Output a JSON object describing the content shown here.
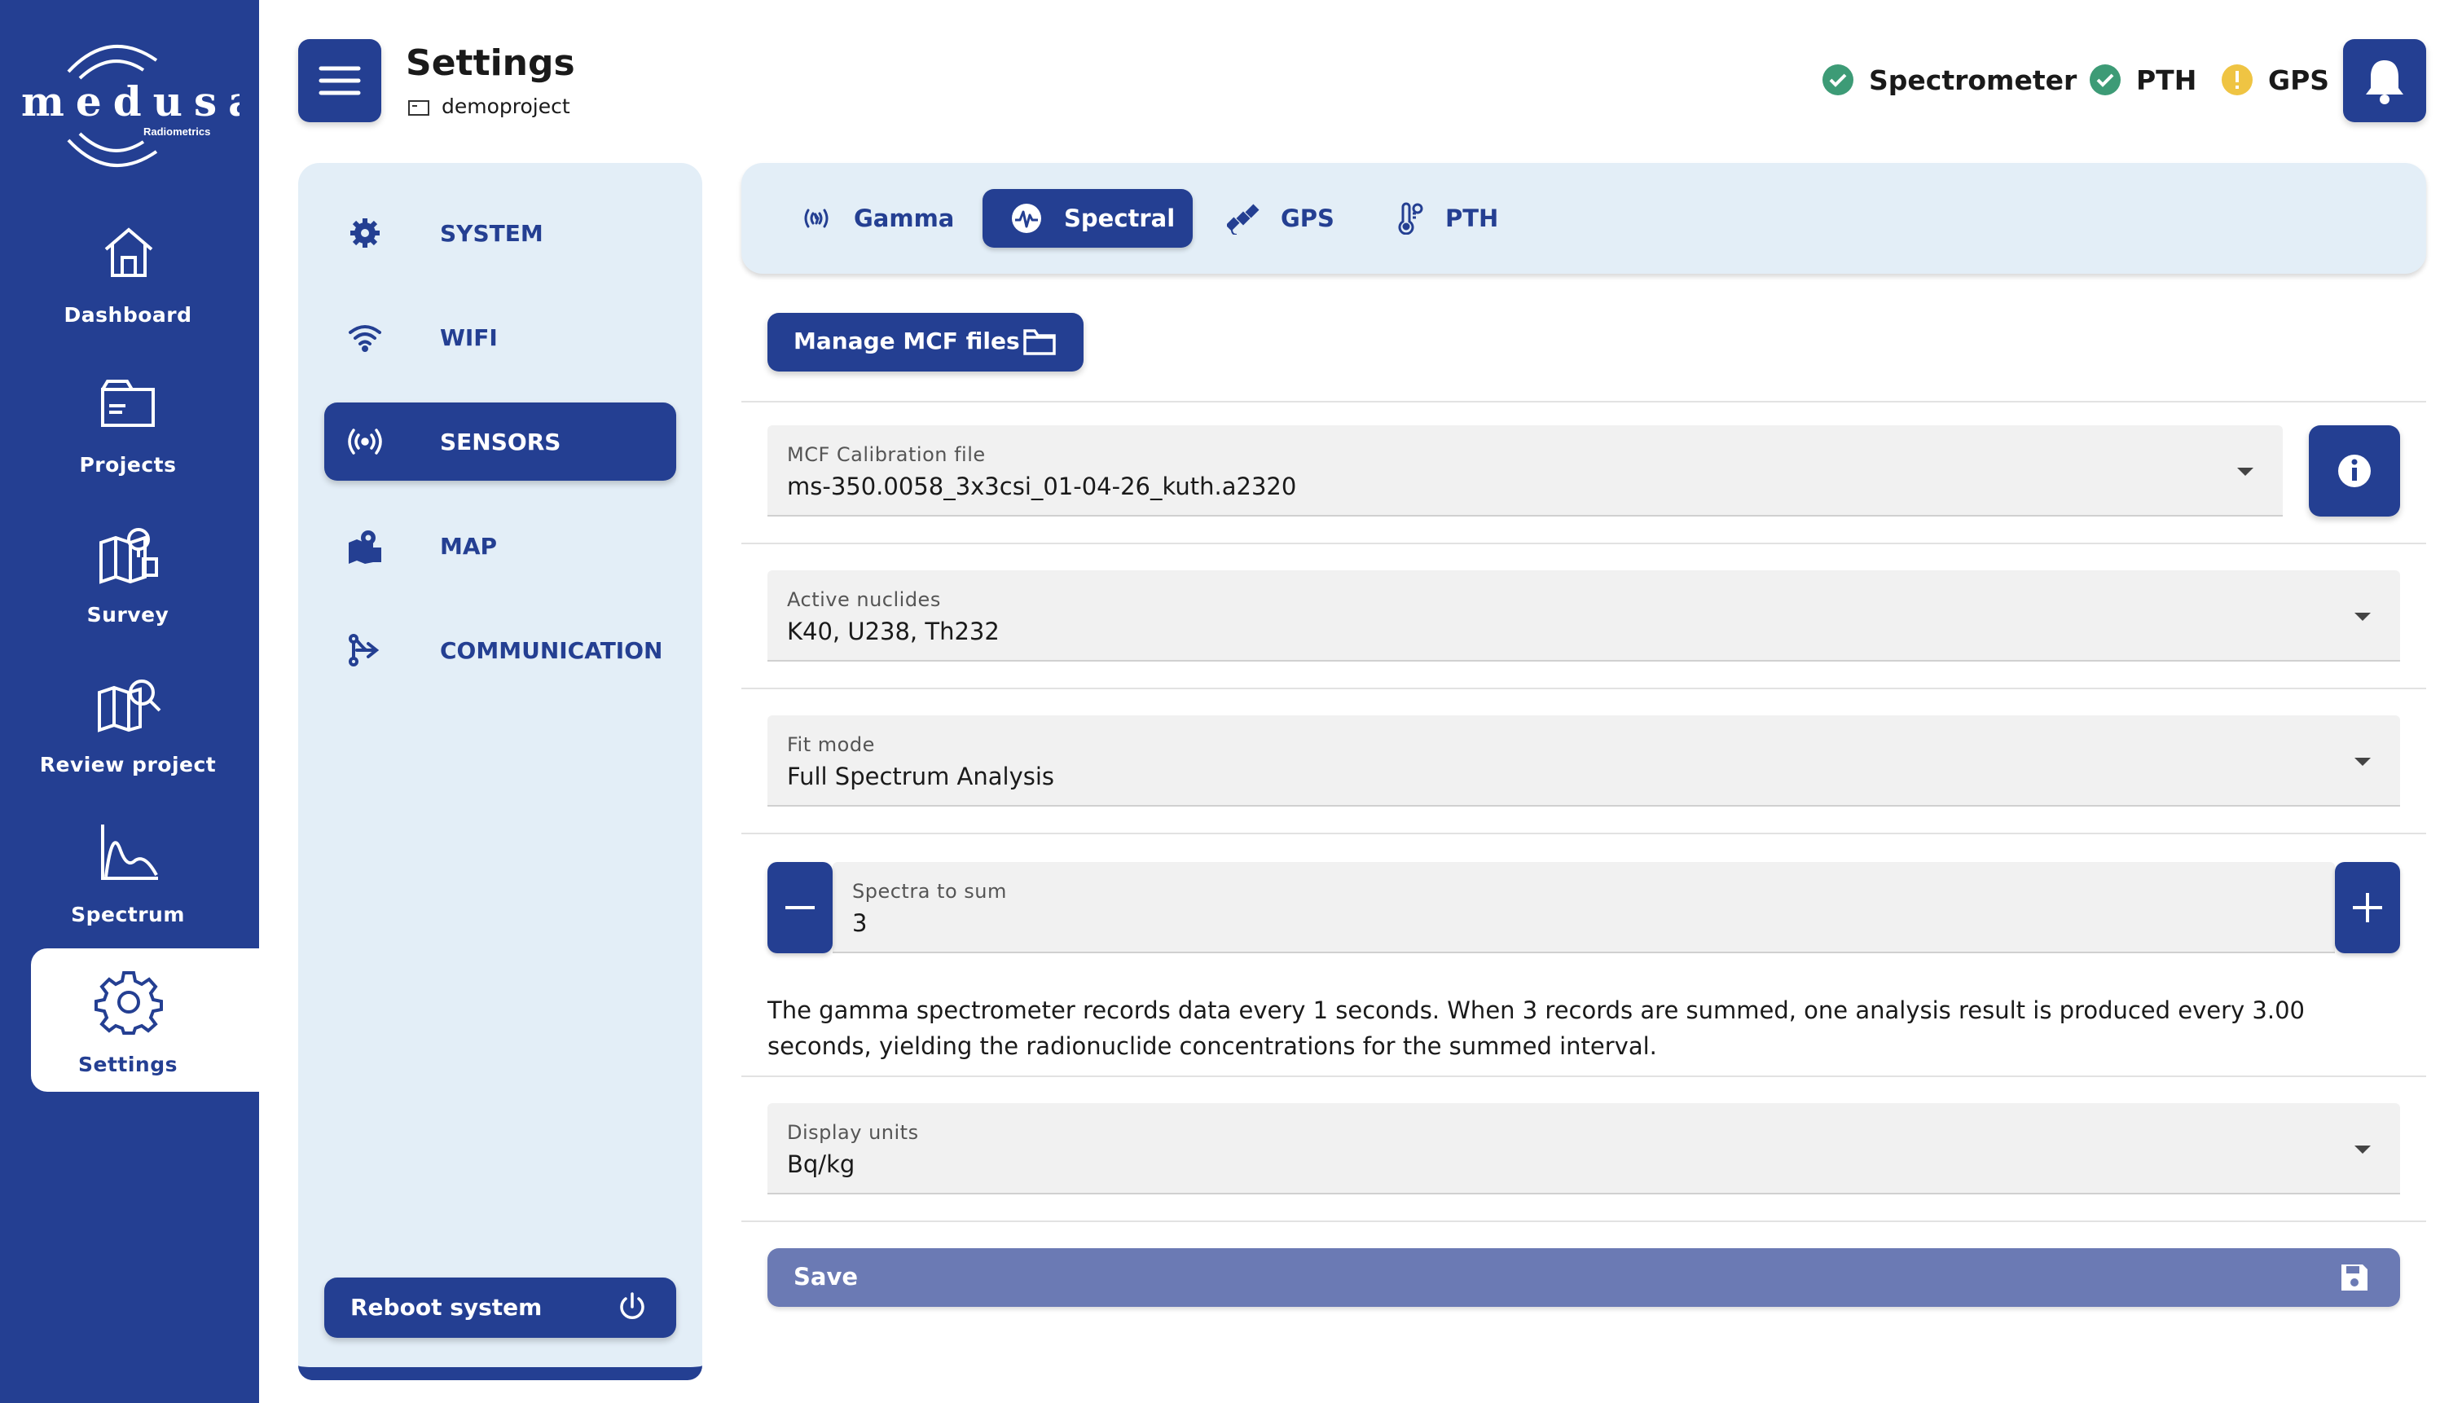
{
  "brand": {
    "name": "medusa",
    "sub": "Radiometrics"
  },
  "rail": [
    {
      "icon": "home-icon",
      "label": "Dashboard"
    },
    {
      "icon": "folder-icon",
      "label": "Projects"
    },
    {
      "icon": "survey-map-icon",
      "label": "Survey"
    },
    {
      "icon": "review-map-icon",
      "label": "Review project"
    },
    {
      "icon": "spectrum-icon",
      "label": "Spectrum"
    },
    {
      "icon": "gear-icon",
      "label": "Settings",
      "active": true
    }
  ],
  "header": {
    "title": "Settings",
    "project": "demoproject",
    "statuses": [
      {
        "label": "Spectrometer",
        "state": "ok",
        "color": "#3d9b76"
      },
      {
        "label": "PTH",
        "state": "ok",
        "color": "#3d9b76"
      },
      {
        "label": "GPS",
        "state": "warning",
        "color": "#efc443"
      }
    ]
  },
  "settings_nav": {
    "items": [
      {
        "icon": "gear-icon",
        "label": "SYSTEM"
      },
      {
        "icon": "wifi-icon",
        "label": "WIFI"
      },
      {
        "icon": "sensor-icon",
        "label": "SENSORS",
        "active": true
      },
      {
        "icon": "map-icon",
        "label": "MAP"
      },
      {
        "icon": "communication-icon",
        "label": "COMMUNICATION"
      }
    ],
    "reboot_label": "Reboot system"
  },
  "tabs": [
    {
      "icon": "gamma-icon",
      "label": "Gamma"
    },
    {
      "icon": "spectral-icon",
      "label": "Spectral",
      "active": true
    },
    {
      "icon": "satellite-icon",
      "label": "GPS"
    },
    {
      "icon": "thermometer-icon",
      "label": "PTH"
    }
  ],
  "content": {
    "manage_label": "Manage MCF files",
    "mcf": {
      "label": "MCF Calibration file",
      "value": "ms-350.0058_3x3csi_01-04-26_kuth.a2320"
    },
    "nuclides": {
      "label": "Active nuclides",
      "value": "K40, U238, Th232"
    },
    "fit_mode": {
      "label": "Fit mode",
      "value": "Full Spectrum Analysis"
    },
    "spectra_sum": {
      "label": "Spectra to sum",
      "value": "3"
    },
    "description": "The gamma spectrometer records data every 1 seconds. When 3 records are summed, one analysis result is produced every 3.00 seconds, yielding the radionuclide concentrations for the summed interval.",
    "units": {
      "label": "Display units",
      "value": "Bq/kg"
    },
    "save_label": "Save"
  },
  "colors": {
    "primary": "#243f92",
    "panel": "#e3eef7",
    "save": "#6b7ab4"
  }
}
